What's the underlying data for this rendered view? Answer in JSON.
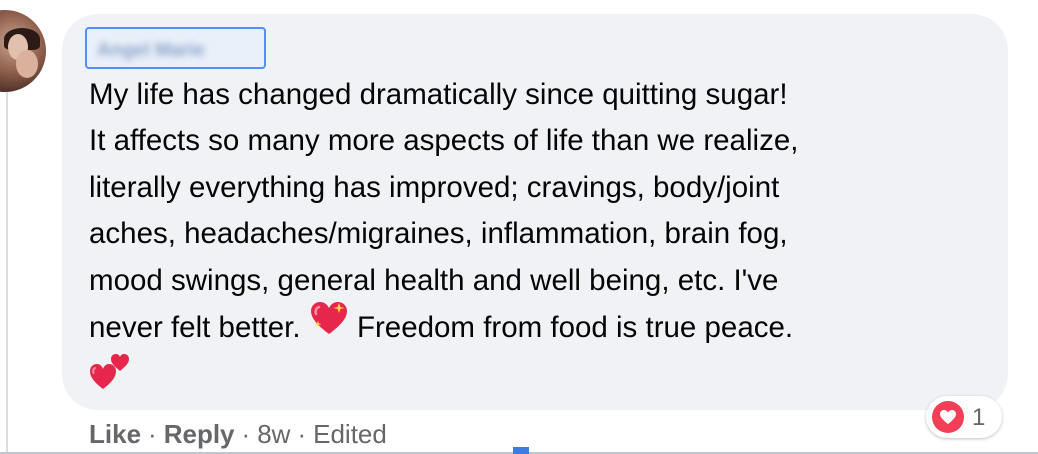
{
  "comment": {
    "author_name": "Angel Marie",
    "text_lines": [
      "My life has changed dramatically since quitting sugar!",
      "It affects so many more aspects of life than we realize,",
      "literally everything has improved; cravings, body/joint",
      "aches, headaches/migraines, inflammation, brain fog,",
      "mood swings, general health and well being, etc. I've",
      "never felt better.",
      "Freedom from food is true peace."
    ],
    "emojis": [
      "sparkling-heart-icon",
      "two-hearts-icon"
    ]
  },
  "reactions": {
    "icon": "love-reaction-icon",
    "count": "1"
  },
  "actions": {
    "like": "Like",
    "reply": "Reply",
    "time": "8w",
    "edited": "Edited",
    "separator": "·"
  },
  "colors": {
    "bubble": "#f0f2f5",
    "text": "#050505",
    "meta": "#65676b",
    "love": "#f33e58",
    "focus": "#4d90fe"
  }
}
